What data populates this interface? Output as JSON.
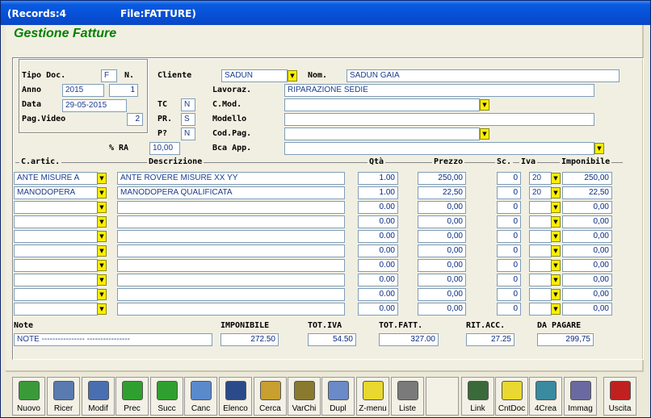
{
  "window": {
    "records": "(Records:4",
    "file": "File:FATTURE)"
  },
  "heading": "Gestione Fatture",
  "header": {
    "tipo_doc_label": "Tipo Doc.",
    "tipo_doc": "F",
    "n_label": "N.",
    "n_value": "",
    "anno_label": "Anno",
    "anno": "2015",
    "anno_n": "1",
    "data_label": "Data",
    "data": "29-05-2015",
    "pag_label": "Pag.Video",
    "pag": "2",
    "cliente_label": "Cliente",
    "cliente": "SADUN",
    "nom_label": "Nom.",
    "nom": "SADUN GAIA",
    "lavoraz_label": "Lavoraz.",
    "lavoraz": "RIPARAZIONE SEDIE",
    "tc_label": "TC",
    "tc": "N",
    "cmod_label": "C.Mod.",
    "cmod": "",
    "pr_label": "PR.",
    "pr": "S",
    "modello_label": "Modello",
    "modello": "",
    "p_label": "P?",
    "p": "N",
    "codpag_label": "Cod.Pag.",
    "codpag": "",
    "ra_label": "% RA",
    "ra": "10,00",
    "bca_label": "Bca App.",
    "bca": ""
  },
  "columns": {
    "cartic": "C.artic.",
    "descr": "Descrizione",
    "qta": "Qtà",
    "prezzo": "Prezzo",
    "sc": "Sc.",
    "iva": "Iva",
    "imponibile": "Imponibile"
  },
  "rows": [
    {
      "cod": "ANTE MISURE A",
      "descr": "ANTE ROVERE MISURE XX YY",
      "qta": "1.00",
      "prezzo": "250,00",
      "sc": "0",
      "iva": "20",
      "imp": "250,00"
    },
    {
      "cod": "MANODOPERA",
      "descr": "MANODOPERA QUALIFICATA",
      "qta": "1.00",
      "prezzo": "22,50",
      "sc": "0",
      "iva": "20",
      "imp": "22,50"
    },
    {
      "cod": "",
      "descr": "",
      "qta": "0.00",
      "prezzo": "0,00",
      "sc": "0",
      "iva": "",
      "imp": "0,00"
    },
    {
      "cod": "",
      "descr": "",
      "qta": "0.00",
      "prezzo": "0,00",
      "sc": "0",
      "iva": "",
      "imp": "0,00"
    },
    {
      "cod": "",
      "descr": "",
      "qta": "0.00",
      "prezzo": "0,00",
      "sc": "0",
      "iva": "",
      "imp": "0,00"
    },
    {
      "cod": "",
      "descr": "",
      "qta": "0.00",
      "prezzo": "0,00",
      "sc": "0",
      "iva": "",
      "imp": "0,00"
    },
    {
      "cod": "",
      "descr": "",
      "qta": "0.00",
      "prezzo": "0,00",
      "sc": "0",
      "iva": "",
      "imp": "0,00"
    },
    {
      "cod": "",
      "descr": "",
      "qta": "0.00",
      "prezzo": "0,00",
      "sc": "0",
      "iva": "",
      "imp": "0,00"
    },
    {
      "cod": "",
      "descr": "",
      "qta": "0.00",
      "prezzo": "0,00",
      "sc": "0",
      "iva": "",
      "imp": "0,00"
    },
    {
      "cod": "",
      "descr": "",
      "qta": "0.00",
      "prezzo": "0,00",
      "sc": "0",
      "iva": "",
      "imp": "0,00"
    }
  ],
  "totals": {
    "note_label": "Note",
    "note": "NOTE ----------------                                      ----------------",
    "imponibile_label": "IMPONIBILE",
    "imponibile": "272.50",
    "totiva_label": "TOT.IVA",
    "totiva": "54.50",
    "totfatt_label": "TOT.FATT.",
    "totfatt": "327.00",
    "ritacc_label": "RIT.ACC.",
    "ritacc": "27.25",
    "dapagare_label": "DA PAGARE",
    "dapagare": "299,75"
  },
  "toolbar": [
    "Nuovo",
    "Ricer",
    "Modif",
    "Prec",
    "Succ",
    "Canc",
    "Elenco",
    "Cerca",
    "VarChi",
    "Dupl",
    "Z-menu",
    "Liste",
    "",
    "Link",
    "CntDoc",
    "4Crea",
    "Immag",
    "Uscita"
  ]
}
